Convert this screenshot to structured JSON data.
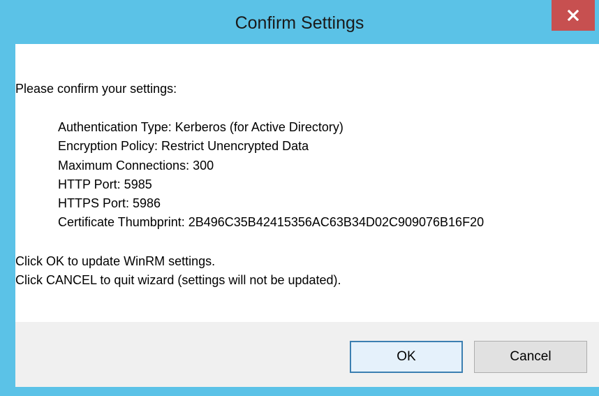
{
  "window": {
    "title": "Confirm Settings",
    "close_glyph": "x",
    "accent_color": "#5bc2e7",
    "close_color": "#c75050"
  },
  "message": {
    "intro": "Please confirm your settings:",
    "settings": [
      "Authentication Type: Kerberos (for Active Directory)",
      "Encryption Policy: Restrict Unencrypted Data",
      "Maximum Connections: 300",
      "HTTP Port: 5985",
      "HTTPS Port: 5986",
      "Certificate Thumbprint: 2B496C35B42415356AC63B34D02C909076B16F20"
    ],
    "ok_hint": "Click OK to update WinRM settings.",
    "cancel_hint": "Click CANCEL to quit wizard (settings will not be updated)."
  },
  "buttons": {
    "ok_label": "OK",
    "cancel_label": "Cancel"
  }
}
